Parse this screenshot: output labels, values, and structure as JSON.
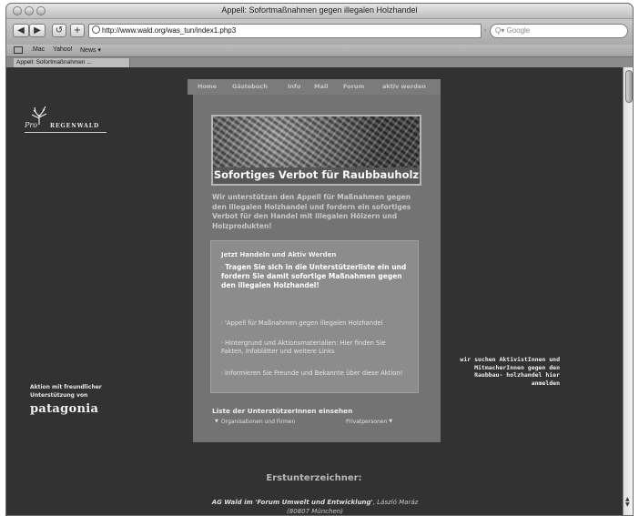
{
  "window": {
    "title": "Appell: Sofortmaßnahmen gegen illegalen Holzhandel"
  },
  "toolbar": {
    "back": "◀",
    "forward": "▶",
    "reload": "↺",
    "add": "+",
    "url": "http://www.wald.org/was_tun/index1.php3",
    "url_end": "◦",
    "search_placeholder": "Q▾ Google"
  },
  "bookmarks": {
    "items": [
      ".Mac",
      "Yahoo!",
      "News ▾"
    ]
  },
  "tab": {
    "label": "Appell: Sofortmaßnahmen ..."
  },
  "left": {
    "logo_pro": "Pro",
    "logo_text": "REGENWALD",
    "aktion_text": "Aktion mit freundlicher Unterstützung von",
    "patagonia": "patagonia"
  },
  "nav": {
    "items": [
      "Home",
      "Gästebuch",
      "Info",
      "Mail",
      "Forum",
      "aktiv werden"
    ]
  },
  "hero": {
    "title": "Sofortiges Verbot für Raubbauholz"
  },
  "intro": "Wir unterstützen den Appell für Maßnahmen gegen den illegalen Holzhandel und fordern ein sofortiges Verbot für den Handel mit illegalen Hölzern und Holzprodukten!",
  "action_box": {
    "heading": "Jetzt Handeln und Aktiv Werden",
    "main": "Tragen Sie sich in die Unterstützerliste ein und fordern Sie damit sofortige Maßnahmen gegen den illegalen Holzhandel!",
    "items": [
      "'Appell für Maßnahmen gegen illegalen Holzhandel",
      "Hintergrund und Aktionsmaterialien: Hier finden Sie Fakten, Infoblätter und weitere Links",
      "Informieren Sie Freunde und Bekannte über diese Aktion!"
    ]
  },
  "liste": {
    "heading": "Liste der UnterstützerInnen einsehen",
    "link1": "Organisationen und Firmen",
    "link2": "Privatpersonen"
  },
  "right": {
    "text": "wir suchen AktivistInnen und MitmacherInnen gegen den Raubbau- holzhandel hier anmelden"
  },
  "signatories": {
    "heading": "Erstunterzeichner:",
    "first_org": "AG Wald im 'Forum Umwelt und Entwicklung'",
    "first_person": ", László Maráz",
    "first_place": "(80807 München)"
  }
}
